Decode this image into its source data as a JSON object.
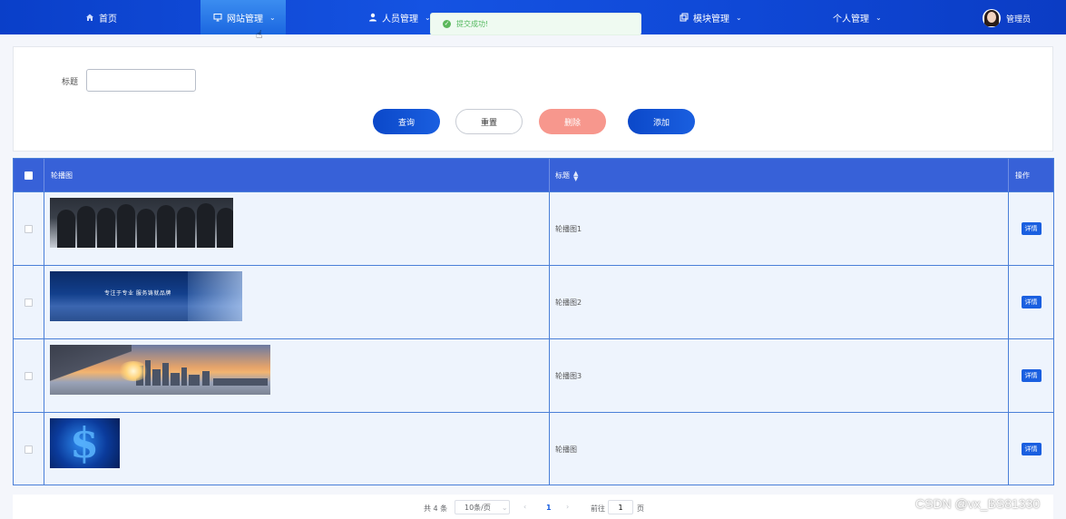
{
  "nav": {
    "items": [
      {
        "label": "首页",
        "icon": "home-icon"
      },
      {
        "label": "网站管理",
        "icon": "monitor-icon",
        "active": true
      },
      {
        "label": "人员管理",
        "icon": "user-icon"
      },
      {
        "label": "模块管理",
        "icon": "copy-icon"
      },
      {
        "label": "个人管理",
        "icon": ""
      }
    ],
    "user_name": "管理员"
  },
  "toast": {
    "message": "提交成功!",
    "icon": "success-check-icon"
  },
  "search": {
    "title_label": "标题",
    "title_value": "",
    "buttons": {
      "query": "查询",
      "reset": "重置",
      "delete": "删除",
      "add": "添加"
    }
  },
  "table": {
    "headers": {
      "image": "轮播图",
      "title": "标题",
      "op": "操作"
    },
    "rows": [
      {
        "title": "轮播图1",
        "action": "详情",
        "image_text": ""
      },
      {
        "title": "轮播图2",
        "action": "详情",
        "image_text": "专注于专业 服务铸就品牌"
      },
      {
        "title": "轮播图3",
        "action": "详情",
        "image_text": ""
      },
      {
        "title": "轮播图",
        "action": "详情",
        "image_text": "$"
      }
    ]
  },
  "pagination": {
    "total": "共 4 条",
    "page_size": "10条/页",
    "current": "1",
    "goto_label": "前往",
    "goto_value": "1",
    "page_suffix": "页"
  },
  "watermark": "CSDN @vx_BS81330",
  "colors": {
    "nav": "#1553e2",
    "header": "#3761d8",
    "primary": "#1a5fe0",
    "danger": "#f7978d",
    "success": "#5cb85c"
  }
}
